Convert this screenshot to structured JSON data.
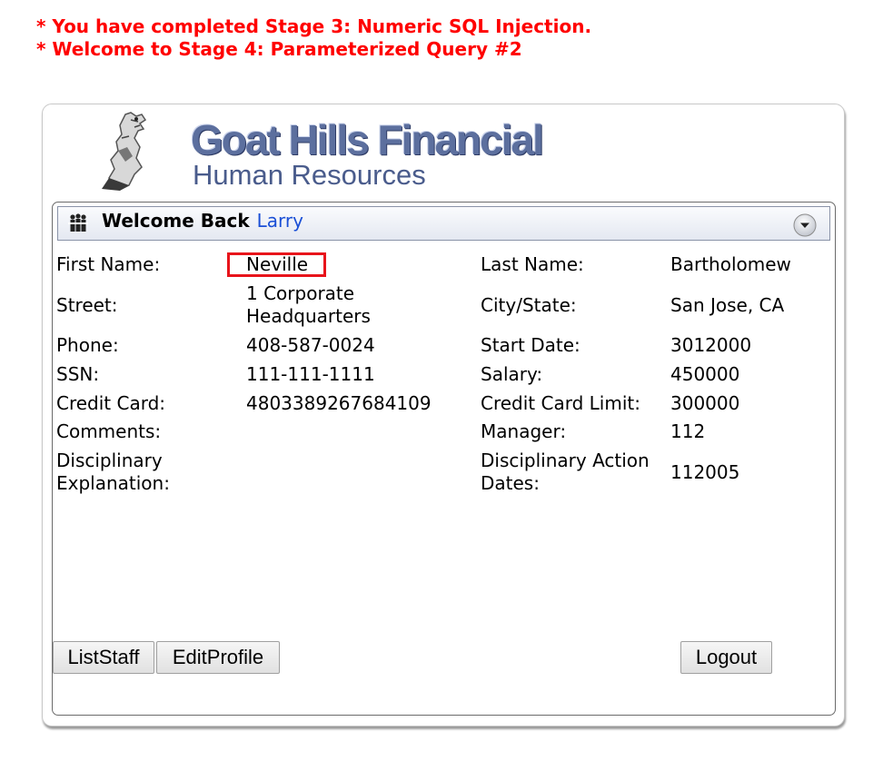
{
  "messages": [
    "* You have completed Stage 3: Numeric SQL Injection.",
    "* Welcome to Stage 4: Parameterized Query #2"
  ],
  "brand": {
    "title": "Goat Hills Financial",
    "subtitle": "Human Resources"
  },
  "header": {
    "welcome": "Welcome Back",
    "user": "Larry"
  },
  "profile": {
    "first_name_label": "First Name:",
    "first_name": "Neville",
    "last_name_label": "Last Name:",
    "last_name": "Bartholomew",
    "street_label": "Street:",
    "street": "1 Corporate Headquarters",
    "city_label": "City/State:",
    "city": "San Jose, CA",
    "phone_label": "Phone:",
    "phone": "408-587-0024",
    "start_date_label": "Start Date:",
    "start_date": "3012000",
    "ssn_label": "SSN:",
    "ssn": "111-111-1111",
    "salary_label": "Salary:",
    "salary": "450000",
    "cc_label": "Credit Card:",
    "cc": "4803389267684109",
    "cc_limit_label": "Credit Card Limit:",
    "cc_limit": "300000",
    "comments_label": "Comments:",
    "comments": "",
    "manager_label": "Manager:",
    "manager": "112",
    "disc_expl_label": "Disciplinary Explanation:",
    "disc_expl": "",
    "disc_dates_label": "Disciplinary Action Dates:",
    "disc_dates": "112005"
  },
  "buttons": {
    "list_staff": "ListStaff",
    "edit_profile": "EditProfile",
    "logout": "Logout"
  },
  "colors": {
    "message": "#ff0000",
    "highlight": "#e8141b",
    "user_link": "#1a4fd6",
    "brand": "#5c6f9e"
  }
}
